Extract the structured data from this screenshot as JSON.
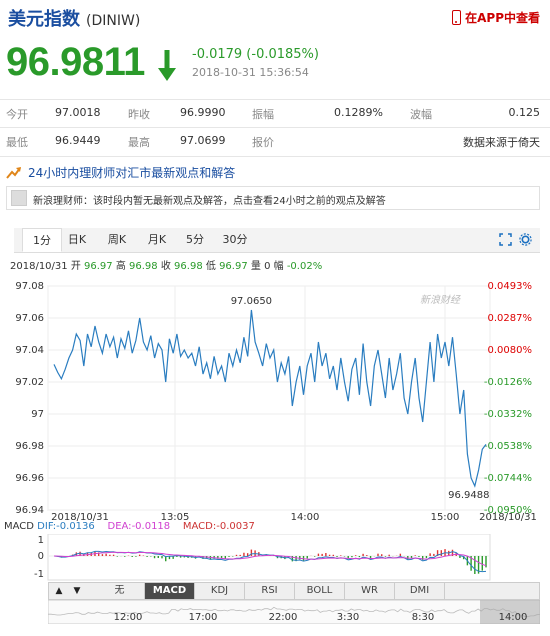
{
  "header": {
    "title": "美元指数",
    "code": "(DINIW)",
    "app_link": "在APP中查看",
    "price": "96.9811",
    "change": "-0.0179 (-0.0185%)",
    "timestamp": "2018-10-31 15:36:54"
  },
  "stats": {
    "row1": [
      {
        "label": "今开",
        "value": "97.0018"
      },
      {
        "label": "昨收",
        "value": "96.9990"
      },
      {
        "label": "振幅",
        "value": "0.1289%"
      },
      {
        "label": "波幅",
        "value": "0.125"
      }
    ],
    "row2": [
      {
        "label": "最低",
        "value": "96.9449"
      },
      {
        "label": "最高",
        "value": "97.0699"
      },
      {
        "label": "报价",
        "value": ""
      },
      {
        "label": "",
        "value": "数据来源于倚天"
      }
    ]
  },
  "news": {
    "heading": "24小时内理财师对汇市最新观点和解答",
    "message": "新浪理财师：该时段内暂无最新观点及解答，点击查看24小时之前的观点及解答"
  },
  "tabs": [
    "1分",
    "日K",
    "周K",
    "月K",
    "5分",
    "30分"
  ],
  "info_line": {
    "date": "2018/10/31",
    "open_label": "开",
    "open": "96.97",
    "high_label": "高",
    "high": "96.98",
    "close_label": "收",
    "close": "96.98",
    "low_label": "低",
    "low": "96.97",
    "vol_label": "量",
    "vol": "0",
    "amp_label": "幅",
    "amp": "-0.02%"
  },
  "chart_data": {
    "type": "line",
    "y_ticks": [
      "97.08",
      "97.06",
      "97.04",
      "97.02",
      "97",
      "96.98",
      "96.96",
      "96.94"
    ],
    "y_range": [
      96.94,
      97.08
    ],
    "pct_ticks": [
      "0.0493%",
      "0.0287%",
      "0.0080%",
      "-0.0126%",
      "-0.0332%",
      "-0.0538%",
      "-0.0744%",
      "-0.0950%"
    ],
    "x_labels": [
      "2018/10/31",
      "13:05",
      "14:00",
      "15:00",
      "2018/10/31"
    ],
    "max_label": "97.0650",
    "min_label": "96.9488",
    "watermark": "新浪财经",
    "values": [
      97.031,
      97.026,
      97.022,
      97.028,
      97.035,
      97.04,
      97.05,
      97.046,
      97.03,
      97.05,
      97.042,
      97.055,
      97.045,
      97.038,
      97.05,
      97.042,
      97.048,
      97.035,
      97.047,
      97.041,
      97.052,
      97.038,
      97.046,
      97.06,
      97.045,
      97.04,
      97.049,
      97.035,
      97.044,
      97.04,
      97.02,
      97.047,
      97.038,
      97.05,
      97.036,
      97.04,
      97.035,
      97.038,
      97.03,
      97.042,
      97.025,
      97.032,
      97.022,
      97.036,
      97.025,
      97.03,
      97.02,
      97.038,
      97.03,
      97.04,
      97.032,
      97.048,
      97.036,
      97.065,
      97.045,
      97.038,
      97.03,
      97.044,
      97.035,
      97.04,
      97.02,
      97.032,
      97.025,
      97.036,
      97.005,
      97.02,
      97.03,
      97.012,
      97.03,
      97.038,
      97.02,
      97.045,
      97.03,
      97.038,
      97.022,
      97.03,
      97.015,
      97.035,
      97.02,
      97.008,
      97.028,
      97.035,
      97.012,
      97.044,
      97.02,
      97.005,
      97.03,
      97.04,
      97.025,
      97.01,
      97.035,
      97.015,
      97.025,
      97.038,
      97.01,
      97.0,
      97.02,
      97.035,
      97.01,
      96.995,
      97.02,
      97.045,
      97.02,
      97.05,
      97.035,
      97.045,
      97.03,
      97.048,
      97.025,
      97.0,
      97.015,
      96.975,
      96.96,
      96.955,
      96.965,
      96.978,
      96.981
    ],
    "macd": {
      "dif": "-0.0136",
      "dea": "-0.0118",
      "macd": "-0.0037",
      "y_ticks": [
        "1",
        "0",
        "-1"
      ]
    },
    "grid": true
  },
  "macd_legend": {
    "name": "MACD",
    "dif_label": "DIF:",
    "dea_label": "DEA:",
    "macd_label": "MACD:"
  },
  "indicators": [
    "无",
    "MACD",
    "KDJ",
    "RSI",
    "BOLL",
    "WR",
    "DMI"
  ],
  "overview_labels": [
    "12:00",
    "17:00",
    "22:00",
    "3:30",
    "8:30",
    "14:00"
  ],
  "colors": {
    "green": "#2a9a2a",
    "red": "#d00",
    "blue": "#1a4ea0",
    "line": "#2a7dc0"
  }
}
